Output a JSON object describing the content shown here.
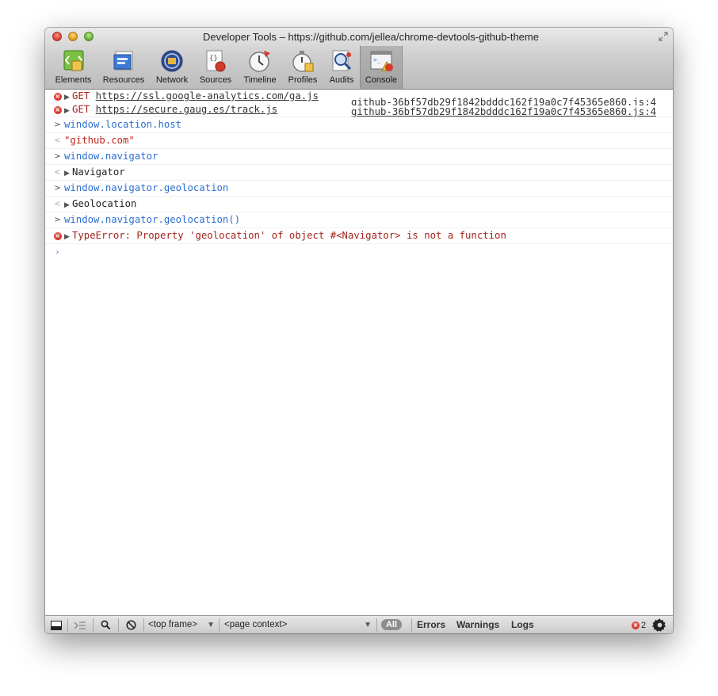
{
  "window": {
    "title": "Developer Tools – https://github.com/jellea/chrome-devtools-github-theme"
  },
  "toolbar": {
    "tabs": [
      {
        "label": "Elements",
        "icon": "elements-icon"
      },
      {
        "label": "Resources",
        "icon": "resources-icon"
      },
      {
        "label": "Network",
        "icon": "network-icon"
      },
      {
        "label": "Sources",
        "icon": "sources-icon"
      },
      {
        "label": "Timeline",
        "icon": "timeline-icon"
      },
      {
        "label": "Profiles",
        "icon": "profiles-icon"
      },
      {
        "label": "Audits",
        "icon": "audits-icon"
      },
      {
        "label": "Console",
        "icon": "console-icon",
        "active": true
      }
    ]
  },
  "console": {
    "error1": {
      "method": "GET",
      "url": "https://ssl.google-analytics.com/ga.js",
      "source": "github-36bf57db29f1842bdddc162f19a0c7f45365e860.js:4"
    },
    "error2": {
      "method": "GET",
      "url": "https://secure.gaug.es/track.js",
      "source": "github-36bf57db29f1842bdddc162f19a0c7f45365e860.js:4"
    },
    "in1": "window.location.host",
    "out1": "\"github.com\"",
    "in2": "window.navigator",
    "out2": "Navigator",
    "in3": "window.navigator.geolocation",
    "out3": "Geolocation",
    "in4": "window.navigator.geolocation()",
    "error3": "TypeError: Property 'geolocation' of object #<Navigator> is not a function"
  },
  "statusbar": {
    "frame_select": "<top frame>",
    "context_select": "<page context>",
    "filters": {
      "all": "All",
      "errors": "Errors",
      "warnings": "Warnings",
      "logs": "Logs"
    },
    "error_count": "2"
  },
  "colors": {
    "error": "#a3241c",
    "input": "#2a6fd0",
    "string": "#c1281c",
    "prompt": "#3d7fd9"
  }
}
